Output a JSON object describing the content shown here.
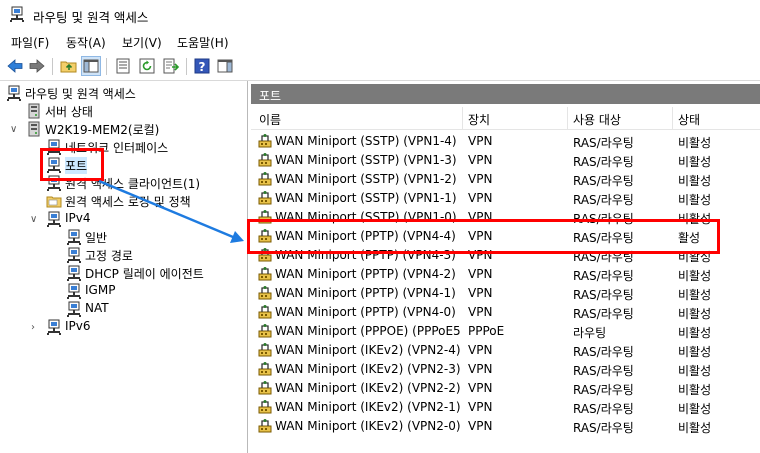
{
  "window": {
    "title": "라우팅 및 원격 액세스"
  },
  "menu": [
    {
      "label": "파일(F)"
    },
    {
      "label": "동작(A)"
    },
    {
      "label": "보기(V)"
    },
    {
      "label": "도움말(H)"
    }
  ],
  "toolbar": {
    "icons": [
      "back-arrow-icon",
      "forward-arrow-icon",
      "up-folder-icon",
      "show-hide-tree-icon",
      "properties-icon",
      "refresh-icon",
      "export-list-icon",
      "help-icon",
      "show-hide-action-pane-icon"
    ]
  },
  "tree": {
    "items": [
      {
        "label": "라우팅 및 원격 액세스"
      },
      {
        "label": "서버 상태"
      },
      {
        "label": "W2K19-MEM2(로컬)"
      },
      {
        "label": "네트워크 인터페이스"
      },
      {
        "label": "포트"
      },
      {
        "label": "원격 액세스 클라이언트(1)"
      },
      {
        "label": "원격 액세스 로깅 및 정책"
      },
      {
        "label": "IPv4"
      },
      {
        "label": "일반"
      },
      {
        "label": "고정 경로"
      },
      {
        "label": "DHCP 릴레이 에이전트"
      },
      {
        "label": "IGMP"
      },
      {
        "label": "NAT"
      },
      {
        "label": "IPv6"
      }
    ]
  },
  "ports": {
    "title": "포트",
    "columns": {
      "name": "이름",
      "device": "장치",
      "used_by": "사용 대상",
      "status": "상태"
    },
    "rows": [
      {
        "name": "WAN Miniport (SSTP) (VPN1-4)",
        "device": "VPN",
        "used_by": "RAS/라우팅",
        "status": "비활성"
      },
      {
        "name": "WAN Miniport (SSTP) (VPN1-3)",
        "device": "VPN",
        "used_by": "RAS/라우팅",
        "status": "비활성"
      },
      {
        "name": "WAN Miniport (SSTP) (VPN1-2)",
        "device": "VPN",
        "used_by": "RAS/라우팅",
        "status": "비활성"
      },
      {
        "name": "WAN Miniport (SSTP) (VPN1-1)",
        "device": "VPN",
        "used_by": "RAS/라우팅",
        "status": "비활성"
      },
      {
        "name": "WAN Miniport (SSTP) (VPN1-0)",
        "device": "VPN",
        "used_by": "RAS/라우팅",
        "status": "비활성"
      },
      {
        "name": "WAN Miniport (PPTP) (VPN4-4)",
        "device": "VPN",
        "used_by": "RAS/라우팅",
        "status": "활성"
      },
      {
        "name": "WAN Miniport (PPTP) (VPN4-3)",
        "device": "VPN",
        "used_by": "RAS/라우팅",
        "status": "비활성"
      },
      {
        "name": "WAN Miniport (PPTP) (VPN4-2)",
        "device": "VPN",
        "used_by": "RAS/라우팅",
        "status": "비활성"
      },
      {
        "name": "WAN Miniport (PPTP) (VPN4-1)",
        "device": "VPN",
        "used_by": "RAS/라우팅",
        "status": "비활성"
      },
      {
        "name": "WAN Miniport (PPTP) (VPN4-0)",
        "device": "VPN",
        "used_by": "RAS/라우팅",
        "status": "비활성"
      },
      {
        "name": "WAN Miniport (PPPOE) (PPPoE5...",
        "device": "PPPoE",
        "used_by": "라우팅",
        "status": "비활성"
      },
      {
        "name": "WAN Miniport (IKEv2) (VPN2-4)",
        "device": "VPN",
        "used_by": "RAS/라우팅",
        "status": "비활성"
      },
      {
        "name": "WAN Miniport (IKEv2) (VPN2-3)",
        "device": "VPN",
        "used_by": "RAS/라우팅",
        "status": "비활성"
      },
      {
        "name": "WAN Miniport (IKEv2) (VPN2-2)",
        "device": "VPN",
        "used_by": "RAS/라우팅",
        "status": "비활성"
      },
      {
        "name": "WAN Miniport (IKEv2) (VPN2-1)",
        "device": "VPN",
        "used_by": "RAS/라우팅",
        "status": "비활성"
      },
      {
        "name": "WAN Miniport (IKEv2) (VPN2-0)",
        "device": "VPN",
        "used_by": "RAS/라우팅",
        "status": "비활성"
      }
    ]
  },
  "colors": {
    "highlight": "#ff0000",
    "arrow": "#1e7be0",
    "pane_header": "#7a7a7a"
  }
}
